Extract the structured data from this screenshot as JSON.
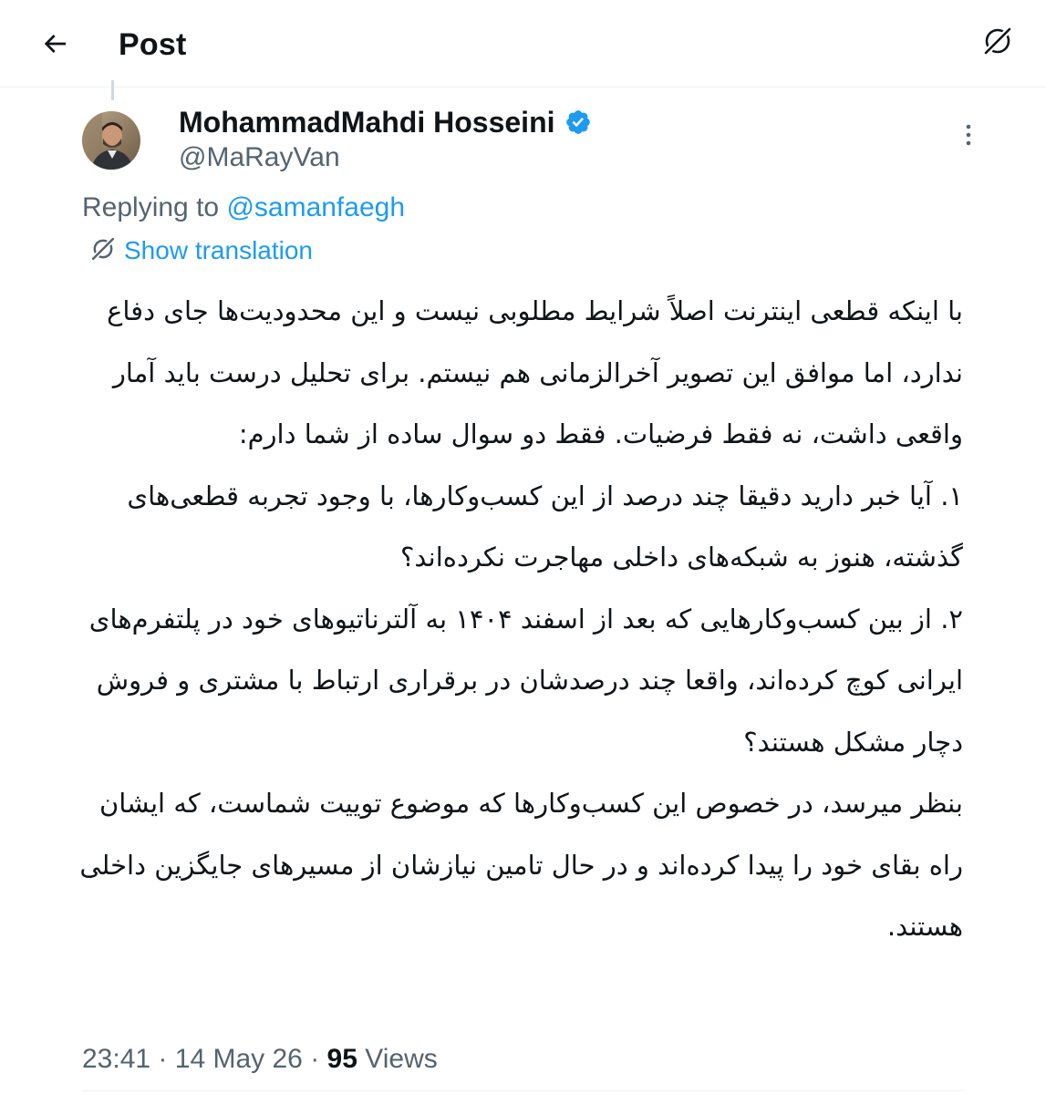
{
  "header": {
    "title": "Post",
    "back_icon": "arrow-left-icon",
    "translate_icon": "grok-translate-icon"
  },
  "author": {
    "name": "MohammadMahdi Hosseini",
    "handle": "@MaRayVan",
    "verified": true,
    "verified_color": "#1d9bf0"
  },
  "reply": {
    "prefix": "Replying to",
    "mention": "@samanfaegh"
  },
  "translation": {
    "label": "Show translation"
  },
  "tweet": {
    "paragraphs": [
      "با اینکه قطعی اینترنت اصلاً شرایط مطلوبی نیست و این محدودیت‌ها جای دفاع ندارد، اما موافق این تصویر آخرالزمانی هم نیستم. برای تحلیل درست باید آمار واقعی داشت، نه فقط فرضیات. فقط دو سوال ساده از شما دارم:",
      "۱. آیا خبر دارید دقیقا چند درصد از این کسب‌وکارها، با وجود تجربه قطعی‌های گذشته، هنوز به شبکه‌های داخلی مهاجرت نکرده‌اند؟",
      "۲. از بین کسب‌وکارهایی که بعد از اسفند ۱۴۰۴ به آلترناتیوهای خود در پلتفرم‌های ایرانی کوچ کرده‌اند، واقعا چند درصدشان در برقراری ارتباط با مشتری و فروش دچار مشکل هستند؟",
      "بنظر میرسد، در خصوص این کسب‌وکارها که موضوع توییت شماست، که ایشان راه بقای خود را پیدا کرده‌اند و در حال تامین نیازشان از مسیرهای جایگزین داخلی هستند."
    ]
  },
  "meta": {
    "time": "23:41",
    "separator": "·",
    "date": "14 May 26",
    "views_count": "95",
    "views_label": "Views"
  },
  "colors": {
    "text_primary": "#0f1419",
    "text_secondary": "#536471",
    "accent": "#1d9bf0",
    "divider": "#eff3f4"
  }
}
